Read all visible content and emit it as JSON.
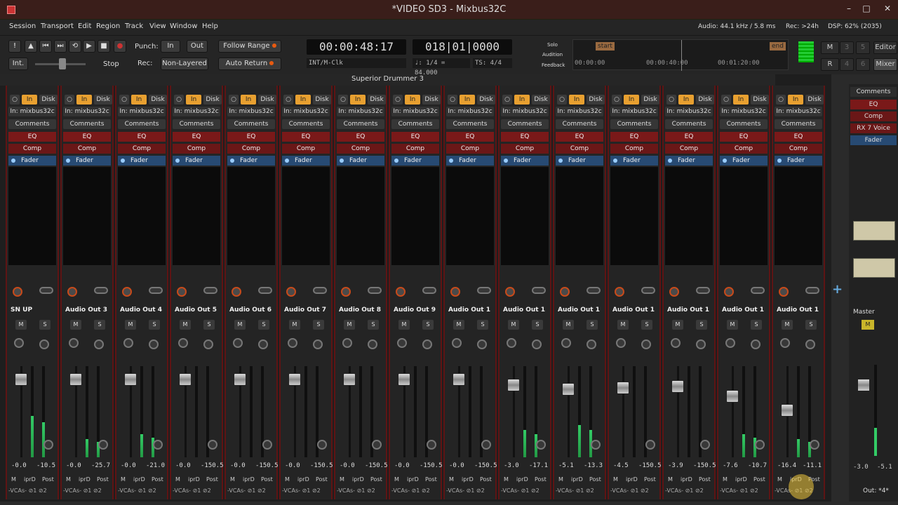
{
  "window": {
    "title": "*VIDEO SD3 - Mixbus32C",
    "minimize": "–",
    "maximize": "□",
    "close": "✕"
  },
  "menu": {
    "items": [
      "Session",
      "Transport",
      "Edit",
      "Region",
      "Track",
      "View",
      "Window",
      "Help"
    ],
    "audio_status": "Audio: 44.1 kHz / 5.8 ms",
    "rec_status": "Rec: >24h",
    "dsp_status": "DSP: 62% (2035)"
  },
  "transport": {
    "punch_label": "Punch:",
    "punch_in": "In",
    "punch_out": "Out",
    "follow_range": "Follow Range",
    "auto_return": "Auto Return",
    "int_label": "Int.",
    "stop_label": "Stop",
    "rec_label": "Rec:",
    "rec_mode": "Non-Layered",
    "primary_clock": "00:00:48:17",
    "secondary_clock": "018|01|0000",
    "sync": "INT/M-Clk",
    "tempo": "♩: 1/4 = 84.000",
    "meter": "TS: 4/4",
    "solo_labels": [
      "Solo",
      "Audition",
      "Feedback"
    ]
  },
  "mini_timeline": {
    "start": "start",
    "end": "end",
    "t0": "00:00:00",
    "t1": "00:00:40:00",
    "t2": "00:01:20:00"
  },
  "view_buttons": {
    "m": "M",
    "r": "R",
    "n3": "3",
    "n4": "4",
    "n5": "5",
    "n6": "6",
    "editor": "Editor",
    "mixer": "Mixer"
  },
  "strips": {
    "plugin_window_title": "Superior Drummer 3",
    "rec_in": "In",
    "rec_disk": "Disk",
    "input": "In: mixbus32c",
    "comments": "Comments",
    "eq": "EQ",
    "comp": "Comp",
    "fader": "Fader",
    "mute": "M",
    "solo": "S",
    "btn_m": "M",
    "btn_iprd": "iprD",
    "btn_post": "Post",
    "vca": "-VCAs-",
    "grp": "⊘1 ⊘2",
    "list": [
      {
        "name": "SN UP",
        "gain": "-0.0",
        "peak": "-10.5",
        "level": 0.45
      },
      {
        "name": "Audio Out 3",
        "gain": "-0.0",
        "peak": "-25.7",
        "level": 0.2
      },
      {
        "name": "Audio Out 4",
        "gain": "-0.0",
        "peak": "-21.0",
        "level": 0.25
      },
      {
        "name": "Audio Out 5",
        "gain": "-0.0",
        "peak": "-150.5",
        "level": 0
      },
      {
        "name": "Audio Out 6",
        "gain": "-0.0",
        "peak": "-150.5",
        "level": 0
      },
      {
        "name": "Audio Out 7",
        "gain": "-0.0",
        "peak": "-150.5",
        "level": 0
      },
      {
        "name": "Audio Out 8",
        "gain": "-0.0",
        "peak": "-150.5",
        "level": 0
      },
      {
        "name": "Audio Out 9",
        "gain": "-0.0",
        "peak": "-150.5",
        "level": 0
      },
      {
        "name": "Audio Out 1",
        "gain": "-0.0",
        "peak": "-150.5",
        "level": 0
      },
      {
        "name": "Audio Out 1",
        "gain": "-3.0",
        "peak": "-17.1",
        "level": 0.3
      },
      {
        "name": "Audio Out 1",
        "gain": "-5.1",
        "peak": "-13.3",
        "level": 0.35
      },
      {
        "name": "Audio Out 1",
        "gain": "-4.5",
        "peak": "-150.5",
        "level": 0
      },
      {
        "name": "Audio Out 1",
        "gain": "-3.9",
        "peak": "-150.5",
        "level": 0
      },
      {
        "name": "Audio Out 1",
        "gain": "-7.6",
        "peak": "-10.7",
        "level": 0.25
      },
      {
        "name": "Audio Out 1",
        "gain": "-16.4",
        "peak": "-11.1",
        "level": 0.2
      }
    ]
  },
  "sidebar": {
    "comments": "Comments",
    "eq": "EQ",
    "comp": "Comp",
    "rx7": "RX 7 Voice",
    "fader": "Fader",
    "master": "Master",
    "gain": "-3.0",
    "peak": "-5.1",
    "out": "Out: *4*",
    "m": "M"
  },
  "colors": {
    "accent_orange": "#e85a10",
    "strip_border": "#5e1414",
    "eq_red": "#7a1919",
    "fader_blue": "#274a73"
  }
}
